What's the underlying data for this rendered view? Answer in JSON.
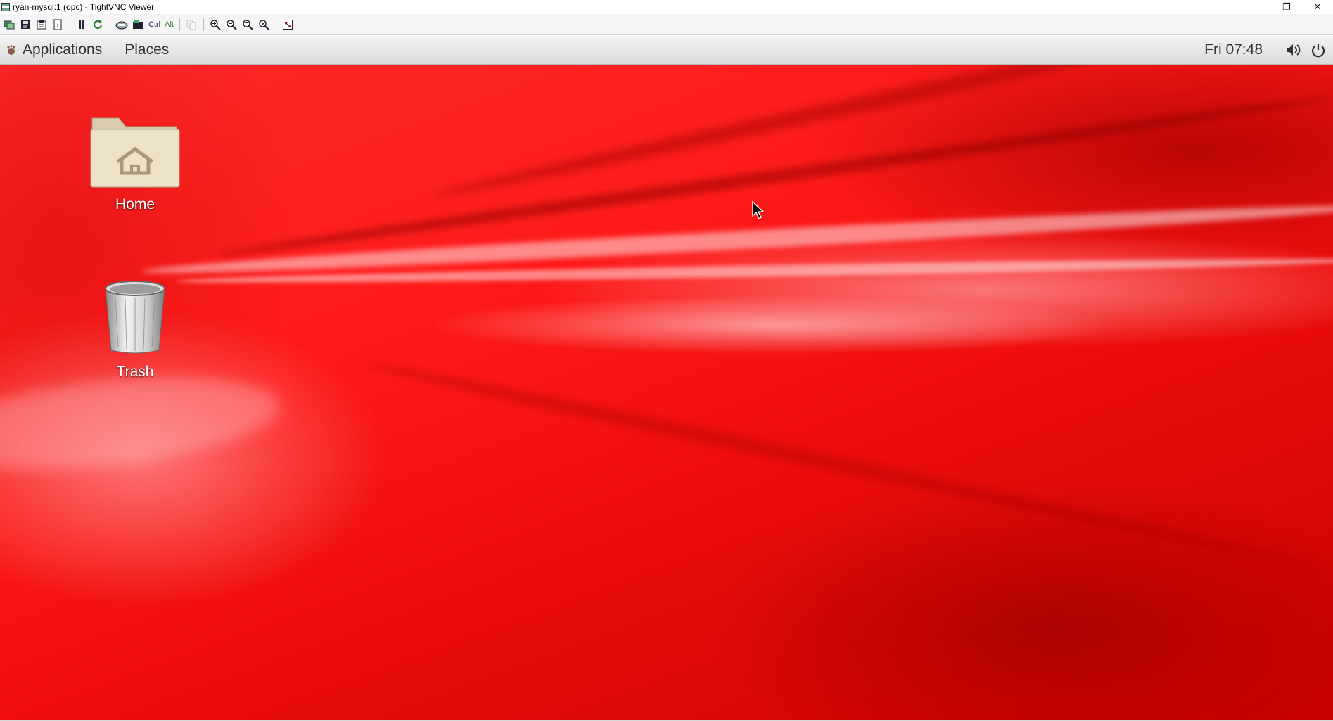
{
  "window": {
    "title": "ryan-mysql:1 (opc) - TightVNC Viewer",
    "controls": {
      "minimize": "–",
      "restore": "❐",
      "close": "✕"
    }
  },
  "toolbar": {
    "buttons": [
      {
        "name": "new-connection-icon"
      },
      {
        "name": "save-icon"
      },
      {
        "name": "options-icon"
      },
      {
        "name": "info-icon"
      },
      {
        "name": "pause-icon"
      },
      {
        "name": "refresh-icon"
      },
      {
        "name": "ctrl-alt-del-icon"
      },
      {
        "name": "ctrl-esc-icon"
      }
    ],
    "ctrl_label": "Ctrl",
    "alt_label": "Alt",
    "zoom_buttons": [
      "zoom-in-icon",
      "zoom-out-icon",
      "zoom-100-icon",
      "zoom-fit-icon"
    ],
    "fullscreen": "fullscreen-icon"
  },
  "panel": {
    "applications_label": "Applications",
    "places_label": "Places",
    "clock": "Fri 07:48"
  },
  "desktop": {
    "icons": [
      {
        "name": "home-folder-icon",
        "label": "Home"
      },
      {
        "name": "trash-icon",
        "label": "Trash"
      }
    ],
    "colors": {
      "accent": "#ff1a1a",
      "dark": "#c80000"
    }
  }
}
